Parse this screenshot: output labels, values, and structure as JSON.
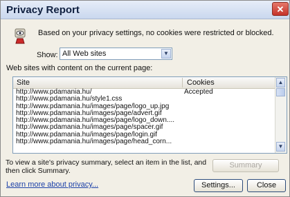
{
  "window": {
    "title": "Privacy Report",
    "close_glyph": "✕"
  },
  "summary_text": "Based on your privacy settings, no cookies were restricted or blocked.",
  "show": {
    "label": "Show:",
    "selected": "All Web sites"
  },
  "list_label": "Web sites with content on the current page:",
  "table": {
    "headers": [
      "Site",
      "Cookies"
    ],
    "rows": [
      {
        "site": "http://www.pdamania.hu/",
        "cookies": "Accepted"
      },
      {
        "site": "http://www.pdamania.hu/style1.css",
        "cookies": ""
      },
      {
        "site": "http://www.pdamania.hu/images/page/logo_up.jpg",
        "cookies": ""
      },
      {
        "site": "http://www.pdamania.hu/images/page/advert.gif",
        "cookies": ""
      },
      {
        "site": "http://www.pdamania.hu/images/page/logo_down....",
        "cookies": ""
      },
      {
        "site": "http://www.pdamania.hu/images/page/spacer.gif",
        "cookies": ""
      },
      {
        "site": "http://www.pdamania.hu/images/page/login.gif",
        "cookies": ""
      },
      {
        "site": "http://www.pdamania.hu/images/page/head_corn...",
        "cookies": ""
      }
    ]
  },
  "info_text": "To view a site's privacy summary, select an item in the list, and then click Summary.",
  "buttons": {
    "summary": "Summary",
    "settings": "Settings...",
    "close": "Close"
  },
  "learn_more": "Learn more about privacy..."
}
